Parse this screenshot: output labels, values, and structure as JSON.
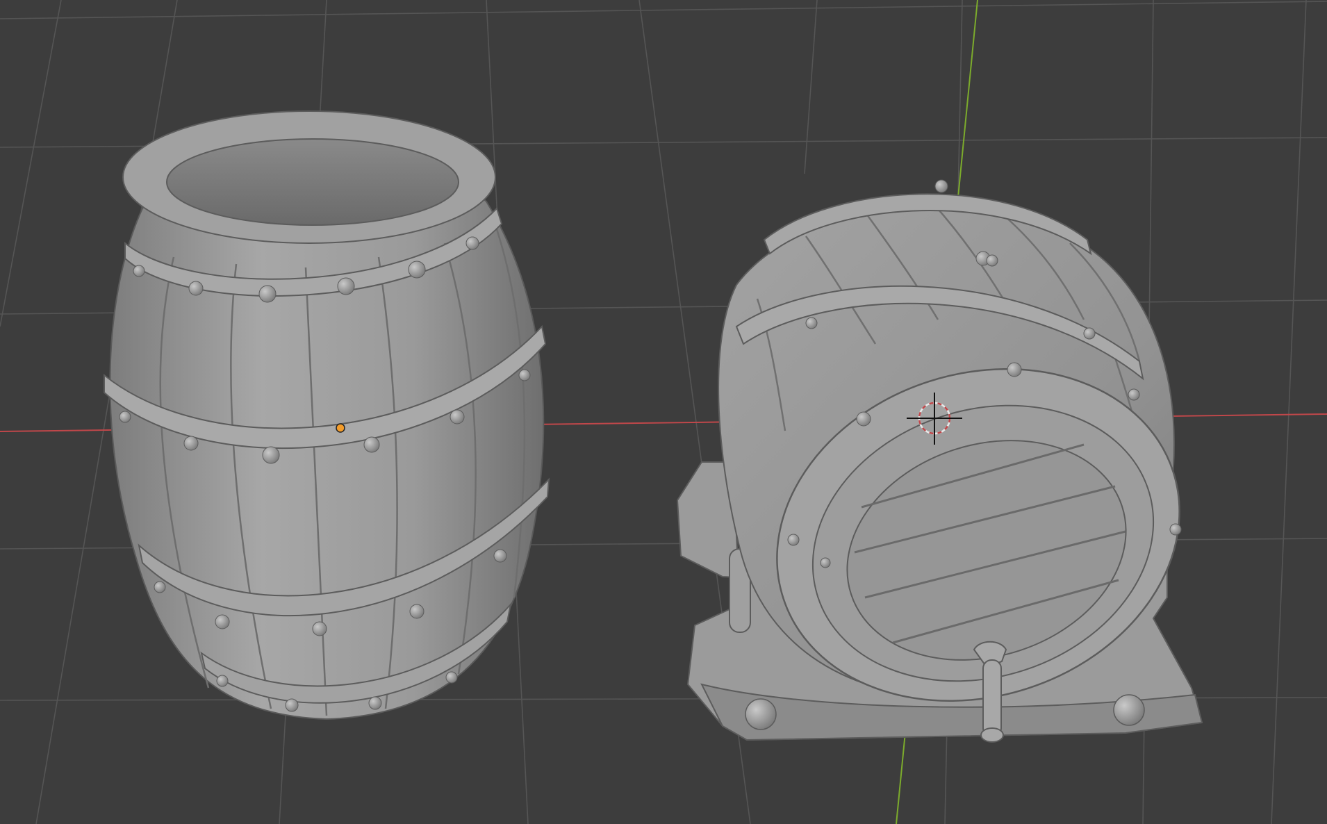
{
  "viewport": {
    "background": "#3d3d3d",
    "grid_color": "#555555",
    "x_axis_color": "#c0474a",
    "y_axis_color": "#7cab2c",
    "mesh_color": "#9a9a9a",
    "origin_color": "#f39c2a"
  },
  "objects": [
    {
      "name": "upright-barrel",
      "icon": "barrel-mesh"
    },
    {
      "name": "lying-barrel-on-stand",
      "icon": "barrel-mesh"
    }
  ],
  "tools": {
    "origin_icon": "object-origin-dot",
    "cursor_icon": "3d-cursor-icon"
  }
}
